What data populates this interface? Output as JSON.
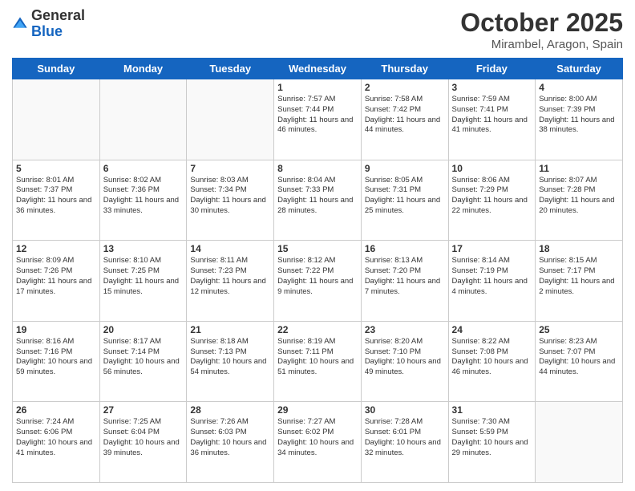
{
  "logo": {
    "general": "General",
    "blue": "Blue"
  },
  "title": "October 2025",
  "subtitle": "Mirambel, Aragon, Spain",
  "days": [
    "Sunday",
    "Monday",
    "Tuesday",
    "Wednesday",
    "Thursday",
    "Friday",
    "Saturday"
  ],
  "weeks": [
    [
      {
        "day": "",
        "text": ""
      },
      {
        "day": "",
        "text": ""
      },
      {
        "day": "",
        "text": ""
      },
      {
        "day": "1",
        "text": "Sunrise: 7:57 AM\nSunset: 7:44 PM\nDaylight: 11 hours and 46 minutes."
      },
      {
        "day": "2",
        "text": "Sunrise: 7:58 AM\nSunset: 7:42 PM\nDaylight: 11 hours and 44 minutes."
      },
      {
        "day": "3",
        "text": "Sunrise: 7:59 AM\nSunset: 7:41 PM\nDaylight: 11 hours and 41 minutes."
      },
      {
        "day": "4",
        "text": "Sunrise: 8:00 AM\nSunset: 7:39 PM\nDaylight: 11 hours and 38 minutes."
      }
    ],
    [
      {
        "day": "5",
        "text": "Sunrise: 8:01 AM\nSunset: 7:37 PM\nDaylight: 11 hours and 36 minutes."
      },
      {
        "day": "6",
        "text": "Sunrise: 8:02 AM\nSunset: 7:36 PM\nDaylight: 11 hours and 33 minutes."
      },
      {
        "day": "7",
        "text": "Sunrise: 8:03 AM\nSunset: 7:34 PM\nDaylight: 11 hours and 30 minutes."
      },
      {
        "day": "8",
        "text": "Sunrise: 8:04 AM\nSunset: 7:33 PM\nDaylight: 11 hours and 28 minutes."
      },
      {
        "day": "9",
        "text": "Sunrise: 8:05 AM\nSunset: 7:31 PM\nDaylight: 11 hours and 25 minutes."
      },
      {
        "day": "10",
        "text": "Sunrise: 8:06 AM\nSunset: 7:29 PM\nDaylight: 11 hours and 22 minutes."
      },
      {
        "day": "11",
        "text": "Sunrise: 8:07 AM\nSunset: 7:28 PM\nDaylight: 11 hours and 20 minutes."
      }
    ],
    [
      {
        "day": "12",
        "text": "Sunrise: 8:09 AM\nSunset: 7:26 PM\nDaylight: 11 hours and 17 minutes."
      },
      {
        "day": "13",
        "text": "Sunrise: 8:10 AM\nSunset: 7:25 PM\nDaylight: 11 hours and 15 minutes."
      },
      {
        "day": "14",
        "text": "Sunrise: 8:11 AM\nSunset: 7:23 PM\nDaylight: 11 hours and 12 minutes."
      },
      {
        "day": "15",
        "text": "Sunrise: 8:12 AM\nSunset: 7:22 PM\nDaylight: 11 hours and 9 minutes."
      },
      {
        "day": "16",
        "text": "Sunrise: 8:13 AM\nSunset: 7:20 PM\nDaylight: 11 hours and 7 minutes."
      },
      {
        "day": "17",
        "text": "Sunrise: 8:14 AM\nSunset: 7:19 PM\nDaylight: 11 hours and 4 minutes."
      },
      {
        "day": "18",
        "text": "Sunrise: 8:15 AM\nSunset: 7:17 PM\nDaylight: 11 hours and 2 minutes."
      }
    ],
    [
      {
        "day": "19",
        "text": "Sunrise: 8:16 AM\nSunset: 7:16 PM\nDaylight: 10 hours and 59 minutes."
      },
      {
        "day": "20",
        "text": "Sunrise: 8:17 AM\nSunset: 7:14 PM\nDaylight: 10 hours and 56 minutes."
      },
      {
        "day": "21",
        "text": "Sunrise: 8:18 AM\nSunset: 7:13 PM\nDaylight: 10 hours and 54 minutes."
      },
      {
        "day": "22",
        "text": "Sunrise: 8:19 AM\nSunset: 7:11 PM\nDaylight: 10 hours and 51 minutes."
      },
      {
        "day": "23",
        "text": "Sunrise: 8:20 AM\nSunset: 7:10 PM\nDaylight: 10 hours and 49 minutes."
      },
      {
        "day": "24",
        "text": "Sunrise: 8:22 AM\nSunset: 7:08 PM\nDaylight: 10 hours and 46 minutes."
      },
      {
        "day": "25",
        "text": "Sunrise: 8:23 AM\nSunset: 7:07 PM\nDaylight: 10 hours and 44 minutes."
      }
    ],
    [
      {
        "day": "26",
        "text": "Sunrise: 7:24 AM\nSunset: 6:06 PM\nDaylight: 10 hours and 41 minutes."
      },
      {
        "day": "27",
        "text": "Sunrise: 7:25 AM\nSunset: 6:04 PM\nDaylight: 10 hours and 39 minutes."
      },
      {
        "day": "28",
        "text": "Sunrise: 7:26 AM\nSunset: 6:03 PM\nDaylight: 10 hours and 36 minutes."
      },
      {
        "day": "29",
        "text": "Sunrise: 7:27 AM\nSunset: 6:02 PM\nDaylight: 10 hours and 34 minutes."
      },
      {
        "day": "30",
        "text": "Sunrise: 7:28 AM\nSunset: 6:01 PM\nDaylight: 10 hours and 32 minutes."
      },
      {
        "day": "31",
        "text": "Sunrise: 7:30 AM\nSunset: 5:59 PM\nDaylight: 10 hours and 29 minutes."
      },
      {
        "day": "",
        "text": ""
      }
    ]
  ]
}
